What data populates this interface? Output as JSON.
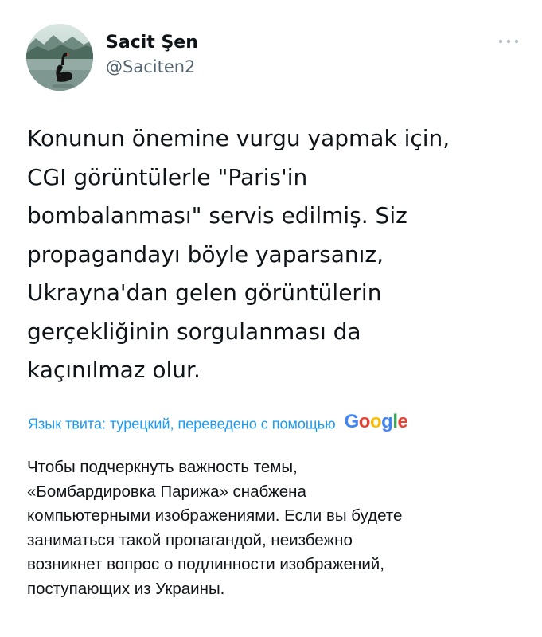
{
  "author": {
    "display_name": "Sacit Şen",
    "handle": "@Saciten2"
  },
  "icons": {
    "avatar": "black-swan-avatar",
    "more": "more-options-icon"
  },
  "tweet": {
    "text": "Konunun önemine vurgu yapmak için,\nCGI görüntülerle \"Paris'in\nbombalanması\" servis edilmiş. Siz\npropagandayı böyle yaparsanız,\nUkrayna'dan gelen görüntülerin\ngerçekliğinin sorgulanması da\nkaçınılmaz olur."
  },
  "translation": {
    "label": "Язык твита: турецкий, переведено с помощью",
    "provider": "Google",
    "text": "Чтобы подчеркнуть важность темы,\n«Бомбардировка Парижа» снабжена\nкомпьютерными изображениями. Если вы будете\nзаниматься такой пропагандой, неизбежно\nвозникнет вопрос о подлинности изображений,\nпоступающих из Украины."
  },
  "colors": {
    "link_blue": "#1d9bf0",
    "text_primary": "#0f1419",
    "text_secondary": "#536471",
    "google_blue": "#4285F4",
    "google_red": "#EA4335",
    "google_yellow": "#FBBC05",
    "google_green": "#34A853"
  }
}
